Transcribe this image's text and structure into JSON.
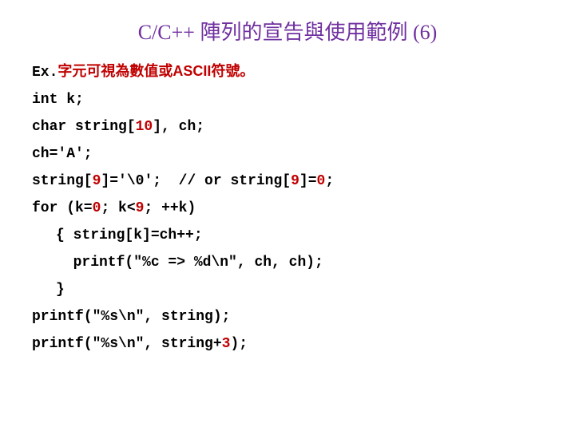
{
  "title": "C/C++ 陣列的宣告與使用範例 (6)",
  "subtitle_prefix": "Ex.",
  "subtitle_cjk": "字元可視為數值或ASCII符號。",
  "lines": {
    "l1": "int k;",
    "l2_a": "char string[",
    "l2_b": "10",
    "l2_c": "], ch;",
    "l3": "ch='A';",
    "l4_a": "string[",
    "l4_b": "9",
    "l4_c": "]='\\0';  // or string[",
    "l4_d": "9",
    "l4_e": "]=",
    "l4_f": "0",
    "l4_g": ";",
    "l5_a": "for (k=",
    "l5_b": "0",
    "l5_c": "; k<",
    "l5_d": "9",
    "l5_e": "; ++k)",
    "l6": "{ string[k]=ch++;",
    "l7": "  printf(\"%c => %d\\n\", ch, ch);",
    "l8": "}",
    "l9": "printf(\"%s\\n\", string);",
    "l10_a": "printf(\"%s\\n\", string+",
    "l10_b": "3",
    "l10_c": ");"
  }
}
